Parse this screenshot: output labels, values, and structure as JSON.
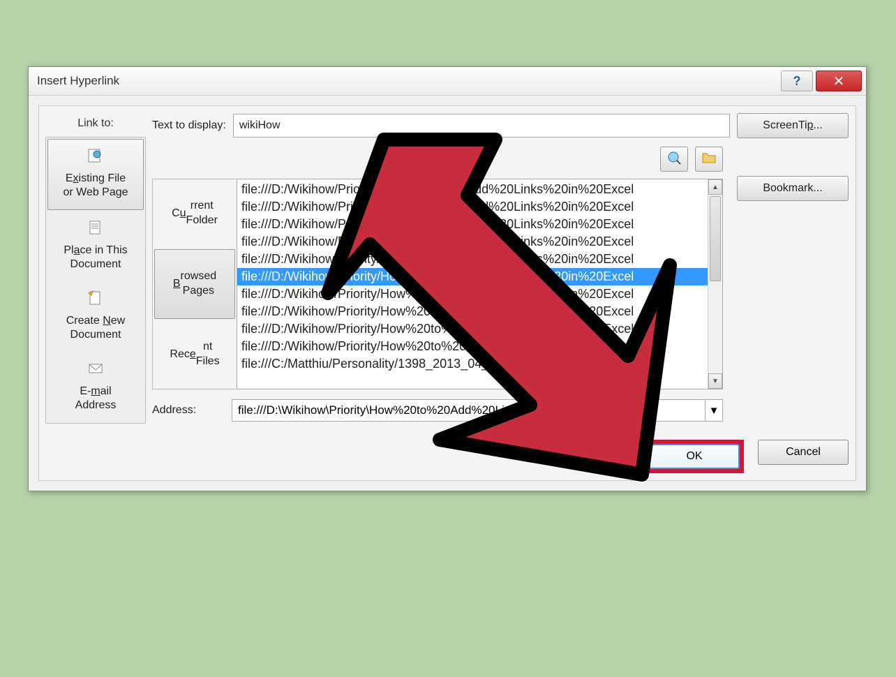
{
  "title": "Insert Hyperlink",
  "linkToLabel": "Link to:",
  "linkOptions": [
    {
      "label1": "Existing File",
      "label2": "or Web Page",
      "underline": "x",
      "selected": true
    },
    {
      "label1": "Place in This",
      "label2": "Document",
      "underline": "A"
    },
    {
      "label1": "Create New",
      "label2": "Document",
      "underline": "N"
    },
    {
      "label1": "E-mail",
      "label2": "Address",
      "underline": "m"
    }
  ],
  "textToDisplayLabel": "Text to display:",
  "textToDisplayValue": "wikiHow",
  "screenTipLabel": "ScreenTip...",
  "bookmarkLabel": "Bookmark...",
  "tabs": [
    {
      "line1": "Current",
      "line2": "Folder",
      "underline": "u",
      "selected": false
    },
    {
      "line1": "Browsed",
      "line2": "Pages",
      "underline": "B",
      "selected": true
    },
    {
      "line1": "Recent",
      "line2": "Files",
      "underline": "",
      "selected": false
    }
  ],
  "fileItems": [
    "file:///D:/Wikihow/Priority/How%20to%20Add%20Links%20in%20Excel",
    "file:///D:/Wikihow/Priority/How%20to%20Add%20Links%20in%20Excel",
    "file:///D:/Wikihow/Priority/How%20to%20Add%20Links%20in%20Excel",
    "file:///D:/Wikihow/Priority/How%20to%20Add%20Links%20in%20Excel",
    "file:///D:/Wikihow/Priority/How%20to%20Add%20Links%20in%20Excel",
    "file:///D:/Wikihow/Priority/How%20to%20Add%20Links%20in%20Excel",
    "file:///D:/Wikihow/Priority/How%20to%20Add%20Links%20in%20Excel",
    "file:///D:/Wikihow/Priority/How%20to%20Add%20Links%20in%20Excel",
    "file:///D:/Wikihow/Priority/How%20to%20Add%20Links%20in%20Excel",
    "file:///D:/Wikihow/Priority/How%20to%20Add%20Links%20in%20Excel",
    "file:///C:/Matthiu/Personality/1398_2013_04_17_05_43_40_91518684"
  ],
  "selectedFileIndex": 5,
  "addressLabel": "Address:",
  "addressValue": "file:///D:\\Wikihow\\Priority\\How%20to%20Add%20Links%20in%20Excel",
  "okLabel": "OK",
  "cancelLabel": "Cancel"
}
